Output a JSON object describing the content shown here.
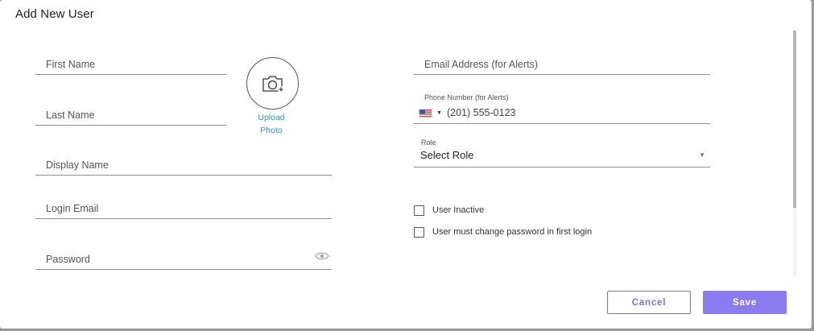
{
  "dialog": {
    "title": "Add New User"
  },
  "left_fields": {
    "first_name": "First Name",
    "last_name": "Last Name",
    "display_name": "Display Name",
    "login_email": "Login Email",
    "password": "Password"
  },
  "photo": {
    "upload_line1": "Upload",
    "upload_line2": "Photo",
    "icon": "camera-plus-icon"
  },
  "right_fields": {
    "email_alerts": "Email Address (for Alerts)",
    "phone_label": "Phone Number (for Alerts)",
    "phone_placeholder": "(201) 555-0123",
    "phone_country": "us-flag-icon",
    "role_label": "Role",
    "role_value": "Select Role"
  },
  "checkboxes": {
    "user_inactive": "User Inactive",
    "must_change_password": "User must change password in first login"
  },
  "buttons": {
    "cancel": "Cancel",
    "save": "Save"
  },
  "colors": {
    "accent": "#8a7cf0",
    "link": "#3a8fc4"
  }
}
